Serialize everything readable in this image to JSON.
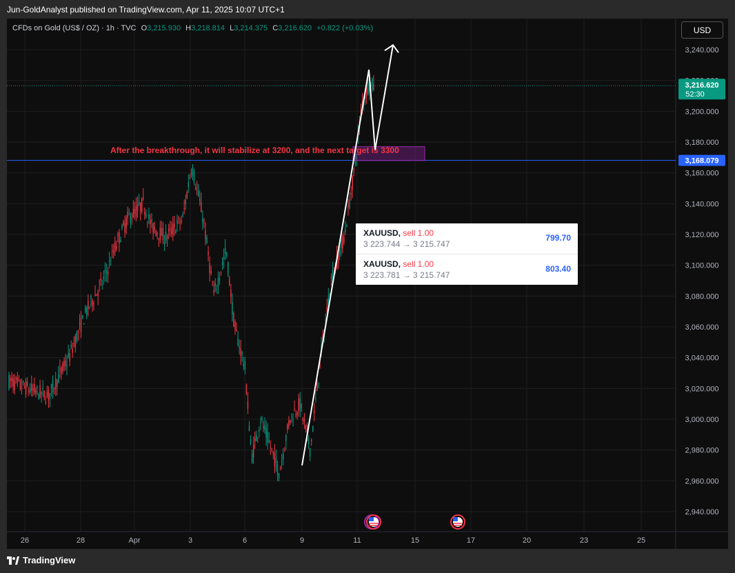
{
  "header": {
    "published": "Jun-GoldAnalyst published on TradingView.com, Apr 11, 2025 10:07 UTC+1"
  },
  "legend": {
    "symbol": "CFDs on Gold (US$ / OZ) · 1h · TVC",
    "o_label": "O",
    "o_value": "3,215.930",
    "h_label": "H",
    "h_value": "3,218.814",
    "l_label": "L",
    "l_value": "3,214.375",
    "c_label": "C",
    "c_value": "3,216.620",
    "change": "+0.822 (+0.03%)"
  },
  "currency_button": "USD",
  "annotation": "After the breakthrough, it will stabilize at 3200, and the next target is 3300",
  "trades": [
    {
      "symbol": "XAUUSD",
      "side": "sell 1.00",
      "path": "3 223.744 → 3 215.747",
      "pnl": "799.70"
    },
    {
      "symbol": "XAUUSD",
      "side": "sell 1.00",
      "path": "3 223.781 → 3 215.747",
      "pnl": "803.40"
    }
  ],
  "footer": {
    "brand": "TradingView"
  },
  "chart_data": {
    "type": "candlestick",
    "timeframe": "1h",
    "y_ticks": [
      2940,
      2960,
      2980,
      3000,
      3020,
      3040,
      3060,
      3080,
      3100,
      3120,
      3140,
      3160,
      3180,
      3200,
      3220,
      3240
    ],
    "y_tick_labels": [
      "2,940.000",
      "2,960.000",
      "2,980.000",
      "3,000.000",
      "3,020.000",
      "3,040.000",
      "3,060.000",
      "3,080.000",
      "3,100.000",
      "3,120.000",
      "3,140.000",
      "3,160.000",
      "3,180.000",
      "3,200.000",
      "3,220.000",
      "3,240.000"
    ],
    "ylim": [
      2932,
      3263
    ],
    "x_tick_labels": [
      "26",
      "28",
      "Apr",
      "3",
      "6",
      "9",
      "11",
      "15",
      "17",
      "20",
      "23",
      "25"
    ],
    "current_price": {
      "label": "3,216.620",
      "countdown": "52:30",
      "value": 3216.62,
      "color": "#089981"
    },
    "horizontal_line": {
      "label": "3,168.079",
      "value": 3168.079,
      "color": "#2962ff"
    },
    "zone": {
      "from_price": 3168,
      "to_price": 3177,
      "color": "#9c27b0"
    },
    "projection_path": [
      [
        2970,
        "start"
      ],
      [
        3227,
        "peak"
      ],
      [
        3175,
        "pullback"
      ],
      [
        3243,
        "target"
      ]
    ],
    "colors": {
      "up": "#089981",
      "down": "#f23645"
    }
  }
}
